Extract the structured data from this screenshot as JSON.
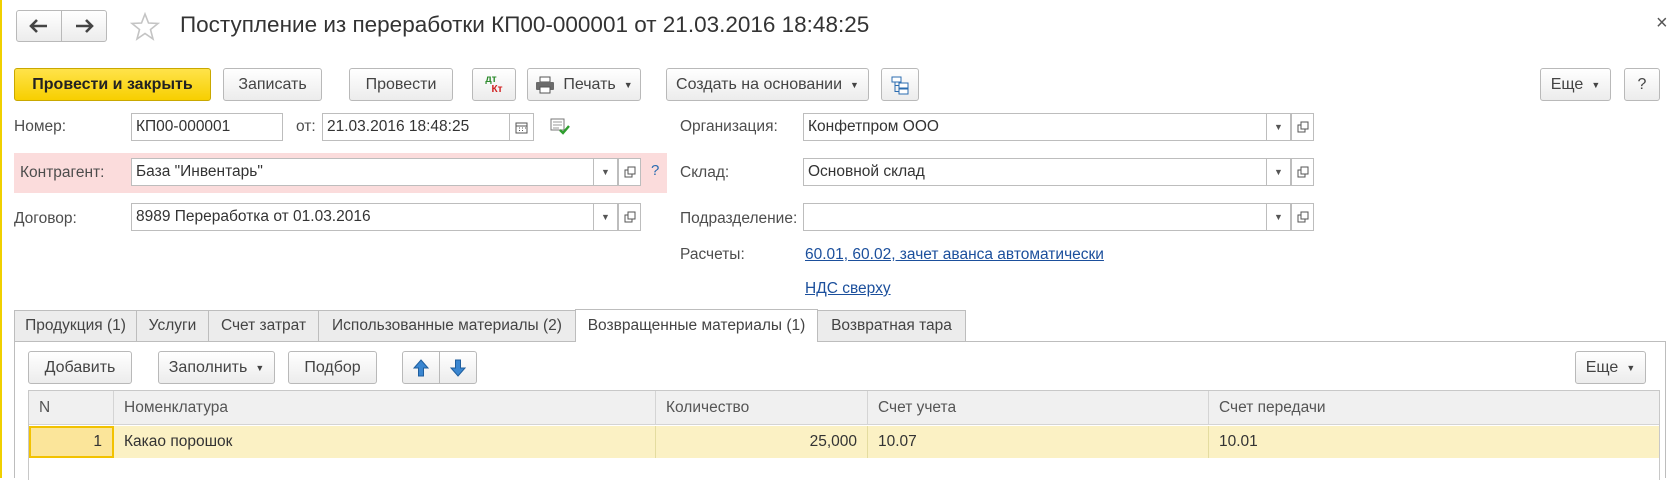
{
  "nav": {
    "back_icon": "arrow-left-icon",
    "forward_icon": "arrow-right-icon",
    "favorite_icon": "star-icon"
  },
  "window": {
    "title": "Поступление из переработки КП00-000001 от 21.03.2016 18:48:25",
    "close": "×"
  },
  "toolbar": {
    "post_close": "Провести и закрыть",
    "save": "Записать",
    "post": "Провести",
    "dtkt_dt": "дт",
    "dtkt_kt": "Кт",
    "print": "Печать",
    "create_based": "Создать на основании",
    "more": "Еще",
    "help": "?"
  },
  "form": {
    "number_label": "Номер:",
    "number_value": "КП00-000001",
    "from_label": "от:",
    "date_value": "21.03.2016 18:48:25",
    "counterparty_label": "Контрагент:",
    "counterparty_value": "База \"Инвентарь\"",
    "counterparty_hint": "?",
    "contract_label": "Договор:",
    "contract_value": "8989 Переработка от 01.03.2016",
    "org_label": "Организация:",
    "org_value": "Конфетпром ООО",
    "warehouse_label": "Склад:",
    "warehouse_value": "Основной склад",
    "division_label": "Подразделение:",
    "division_value": "",
    "settlements_label": "Расчеты:",
    "settlements_link": "60.01, 60.02, зачет аванса автоматически",
    "vat_link": "НДС сверху"
  },
  "tabs": [
    {
      "label": "Продукция (1)"
    },
    {
      "label": "Услуги"
    },
    {
      "label": "Счет затрат"
    },
    {
      "label": "Использованные материалы (2)"
    },
    {
      "label": "Возвращенные материалы (1)"
    },
    {
      "label": "Возвратная тара"
    }
  ],
  "table_toolbar": {
    "add": "Добавить",
    "fill": "Заполнить",
    "select": "Подбор",
    "more": "Еще"
  },
  "table": {
    "columns": [
      "N",
      "Номенклатура",
      "Количество",
      "Счет учета",
      "Счет передачи"
    ],
    "rows": [
      {
        "n": "1",
        "item": "Какао порошок",
        "qty": "25,000",
        "account": "10.07",
        "transfer_account": "10.01"
      }
    ]
  },
  "colors": {
    "accent_yellow": "#f7cf00",
    "link_blue": "#1b4f9c",
    "error_bg": "#fbdcdc",
    "selected_row": "#fbf1c4"
  }
}
